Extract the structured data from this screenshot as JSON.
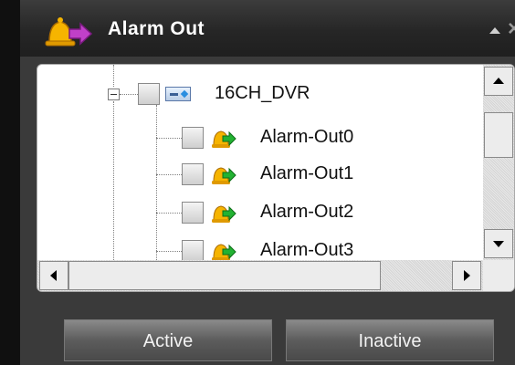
{
  "window": {
    "title": "Alarm Out",
    "title_icon": "alarm-bell-icon",
    "controls": [
      "collapse-up-icon",
      "close-icon"
    ],
    "close_glyph": "×"
  },
  "tree": {
    "root": {
      "label": "16CH_DVR",
      "icon": "dvr-device-icon",
      "expanded": true,
      "checked": false
    },
    "children": [
      {
        "label": "Alarm-Out0",
        "icon": "alarm-output-icon",
        "checked": false
      },
      {
        "label": "Alarm-Out1",
        "icon": "alarm-output-icon",
        "checked": false
      },
      {
        "label": "Alarm-Out2",
        "icon": "alarm-output-icon",
        "checked": false
      },
      {
        "label": "Alarm-Out3",
        "icon": "alarm-output-icon",
        "checked": false
      }
    ]
  },
  "buttons": {
    "active_label": "Active",
    "inactive_label": "Inactive"
  },
  "colors": {
    "frame": "#101010",
    "titlebar": "#2e2e2e",
    "panel_bg": "#3a3a3a",
    "tree_bg": "#ffffff",
    "button_bg": "#6e6e6e",
    "dvr_accent": "#2a8ee0",
    "alarm_arrow": "#1faa2e",
    "bell": "#f0a800"
  }
}
